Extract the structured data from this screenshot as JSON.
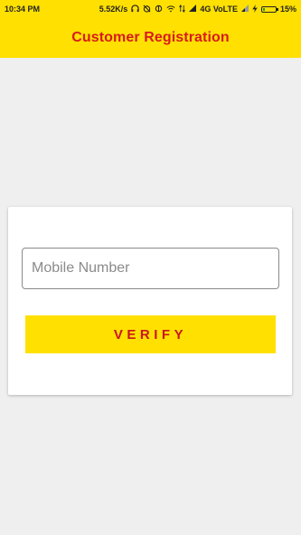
{
  "status_bar": {
    "time": "10:34 PM",
    "net_speed": "5.52K/s",
    "network": "4G VoLTE",
    "battery_percent": "15%",
    "battery_level": 0.15,
    "icons": [
      "headset-icon",
      "alarm-off-icon",
      "cast-icon",
      "wifi-icon",
      "data-arrows-icon",
      "signal-icon",
      "signal-icon-2",
      "charging-icon",
      "battery-icon"
    ]
  },
  "app_bar": {
    "title": "Customer Registration"
  },
  "form": {
    "mobile_placeholder": "Mobile Number",
    "mobile_value": "",
    "verify_label": "VERIFY"
  },
  "colors": {
    "accent_yellow": "#ffe000",
    "title_red": "#d81b1b",
    "button_text_red": "#c8161d",
    "background": "#efefef"
  }
}
